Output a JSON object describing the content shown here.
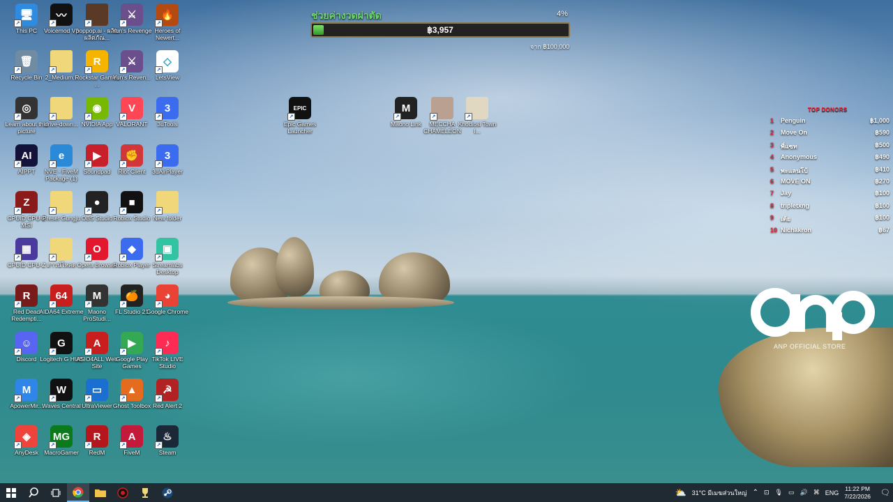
{
  "desktop": {
    "icons": [
      {
        "id": "this-pc",
        "label": "This PC",
        "glyph": "🖥",
        "color": "#2e8be0"
      },
      {
        "id": "voicemod",
        "label": "Voicemod V3",
        "glyph": "〰",
        "color": "#111"
      },
      {
        "id": "poppop",
        "label": "poppop.ai - ผลิตผลิตภัณ...",
        "glyph": "",
        "color": "#5a3a26"
      },
      {
        "id": "yuns-revenge",
        "label": "Yun's Revenge",
        "glyph": "⚔",
        "color": "#6a4f8c"
      },
      {
        "id": "heroes-newerth",
        "label": "Heroes of Newert...",
        "glyph": "🔥",
        "color": "#b24a12"
      },
      {
        "id": "recycle-bin",
        "label": "Recycle Bin",
        "glyph": "🗑",
        "color": "#6f8ca3"
      },
      {
        "id": "2-medium",
        "label": "2_Medium...",
        "glyph": "",
        "color": "#f0d77a"
      },
      {
        "id": "rockstar",
        "label": "Rockstar Games ...",
        "glyph": "R",
        "color": "#f5b400"
      },
      {
        "id": "yuns-revenge-2",
        "label": "Yun's Reven...",
        "glyph": "⚔",
        "color": "#6a4f8c"
      },
      {
        "id": "letsview",
        "label": "LetsView",
        "glyph": "◇",
        "color": "#ffffff"
      },
      {
        "id": "learn-picture",
        "label": "Learn about this picture",
        "glyph": "◎",
        "color": "#333"
      },
      {
        "id": "drive-down",
        "label": "drive-down...",
        "glyph": "",
        "color": "#f0d77a"
      },
      {
        "id": "nvidia-app",
        "label": "NVIDIA App",
        "glyph": "◉",
        "color": "#76b900"
      },
      {
        "id": "valorant",
        "label": "VALORANT",
        "glyph": "V",
        "color": "#ff4655"
      },
      {
        "id": "3utools",
        "label": "3uTools",
        "glyph": "3",
        "color": "#3b6cf0"
      },
      {
        "id": "aippt",
        "label": "AIPPT",
        "glyph": "AI",
        "color": "#12123a"
      },
      {
        "id": "nve-fivem",
        "label": "NVE - FiveM Package (1)",
        "glyph": "e",
        "color": "#2a8ad8"
      },
      {
        "id": "soundpad",
        "label": "Soundpad",
        "glyph": "▶",
        "color": "#c8202a"
      },
      {
        "id": "riot-client",
        "label": "Riot Client",
        "glyph": "✊",
        "color": "#d13639"
      },
      {
        "id": "3uairplayer",
        "label": "3uAirPlayer",
        "glyph": "3",
        "color": "#3b6cf0"
      },
      {
        "id": "cpuid-msi",
        "label": "CPUID CPU-Z MSI",
        "glyph": "Z",
        "color": "#8b1a1a"
      },
      {
        "id": "preset-gungju",
        "label": "Preset Gungju",
        "glyph": "",
        "color": "#f0d77a"
      },
      {
        "id": "obs-studio",
        "label": "OBS Studio",
        "glyph": "●",
        "color": "#222"
      },
      {
        "id": "roblox-studio",
        "label": "Roblox Studio",
        "glyph": "■",
        "color": "#111"
      },
      {
        "id": "new-folder",
        "label": "New folder",
        "glyph": "",
        "color": "#f0d77a"
      },
      {
        "id": "cpuid-cpuz",
        "label": "CPUID CPU-Z",
        "glyph": "▦",
        "color": "#4b3a9e"
      },
      {
        "id": "thai-folder",
        "label": "ดาวน์โหลด",
        "glyph": "",
        "color": "#f0d77a"
      },
      {
        "id": "opera",
        "label": "Opera Browser",
        "glyph": "O",
        "color": "#e3182f"
      },
      {
        "id": "roblox-player",
        "label": "Roblox Player",
        "glyph": "◆",
        "color": "#3b6cf0"
      },
      {
        "id": "streamlabs",
        "label": "Streamlabs Desktop",
        "glyph": "▣",
        "color": "#31c3a2"
      },
      {
        "id": "rdr",
        "label": "Red Dead Redempti...",
        "glyph": "R",
        "color": "#7a1b1b"
      },
      {
        "id": "aida64",
        "label": "AIDA64 Extreme",
        "glyph": "64",
        "color": "#c81e1e"
      },
      {
        "id": "maono-prostudio",
        "label": "Maono ProStudi...",
        "glyph": "M",
        "color": "#333"
      },
      {
        "id": "flstudio",
        "label": "FL Studio 21",
        "glyph": "🍊",
        "color": "#222"
      },
      {
        "id": "chrome",
        "label": "Google Chrome",
        "glyph": "◕",
        "color": "#e94335"
      },
      {
        "id": "discord",
        "label": "Discord",
        "glyph": "☺",
        "color": "#5865f2"
      },
      {
        "id": "logitech",
        "label": "Logitech G HUB",
        "glyph": "G",
        "color": "#111"
      },
      {
        "id": "asio4all",
        "label": "ASIO4ALL Web Site",
        "glyph": "A",
        "color": "#c81e1e"
      },
      {
        "id": "google-play",
        "label": "Google Play Games",
        "glyph": "▶",
        "color": "#34a853"
      },
      {
        "id": "tiktok-live",
        "label": "TikTok LIVE Studio",
        "glyph": "♪",
        "color": "#fe2c55"
      },
      {
        "id": "apowermirror",
        "label": "ApowerMir...",
        "glyph": "M",
        "color": "#2f86e8"
      },
      {
        "id": "waves-central",
        "label": "Waves Central",
        "glyph": "W",
        "color": "#111"
      },
      {
        "id": "ultraviewer",
        "label": "UltraViewer",
        "glyph": "▭",
        "color": "#1b6fd0"
      },
      {
        "id": "ghost-toolbox",
        "label": "Ghost Toolbox",
        "glyph": "▲",
        "color": "#e56b1f"
      },
      {
        "id": "red-alert",
        "label": "Red Alert 2",
        "glyph": "☭",
        "color": "#b22222"
      },
      {
        "id": "anydesk",
        "label": "AnyDesk",
        "glyph": "◈",
        "color": "#ef443b"
      },
      {
        "id": "macrogamer",
        "label": "MacroGamer",
        "glyph": "MG",
        "color": "#0a7a1a"
      },
      {
        "id": "redm",
        "label": "RedM",
        "glyph": "R",
        "color": "#b5161c"
      },
      {
        "id": "fivem",
        "label": "FiveM",
        "glyph": "A",
        "color": "#c3193b"
      },
      {
        "id": "steam",
        "label": "Steam",
        "glyph": "♨",
        "color": "#1b2838"
      },
      {
        "id": "epic",
        "label": "Epic Games Launcher",
        "glyph": "EPIC",
        "color": "#111"
      },
      {
        "id": "maono-link",
        "label": "Maono Link",
        "glyph": "M",
        "color": "#222"
      },
      {
        "id": "meccha",
        "label": "MECCHA CHAMELEON",
        "glyph": "",
        "color": "#b9a090"
      },
      {
        "id": "khodiosi",
        "label": "Khodiosi Town I...",
        "glyph": "",
        "color": "#e0d8c0"
      }
    ]
  },
  "donation": {
    "title": "ช่วยค่างวดผ่าตัด",
    "percent_label": "4%",
    "progress": 0.04,
    "amount": "฿3,957",
    "goal": "จาก ฿100,000"
  },
  "top_donors": {
    "title": "TOP DONORS",
    "items": [
      {
        "rank": "1",
        "name": "Penguin",
        "amount": "฿1,000"
      },
      {
        "rank": "2",
        "name": "Move On",
        "amount": "฿590"
      },
      {
        "rank": "3",
        "name": "พี่แซท",
        "amount": "฿500"
      },
      {
        "rank": "4",
        "name": "Anonymous",
        "amount": "฿490"
      },
      {
        "rank": "5",
        "name": "พะแลนโบ้",
        "amount": "฿410"
      },
      {
        "rank": "6",
        "name": "MOVE ON",
        "amount": "฿270"
      },
      {
        "rank": "7",
        "name": "Jay",
        "amount": "฿100"
      },
      {
        "rank": "8",
        "name": "tripletxng",
        "amount": "฿100"
      },
      {
        "rank": "9",
        "name": "เต้ย",
        "amount": "฿100"
      },
      {
        "rank": "10",
        "name": "Nichakron",
        "amount": "฿67"
      }
    ]
  },
  "watermark": {
    "logo": "anp",
    "text": "ANP OFFICIAL STORE"
  },
  "taskbar": {
    "weather": "31°C มีเมฆส่วนใหญ่",
    "language": "ENG",
    "time": "11:22 PM",
    "date": "7/22/2026"
  }
}
